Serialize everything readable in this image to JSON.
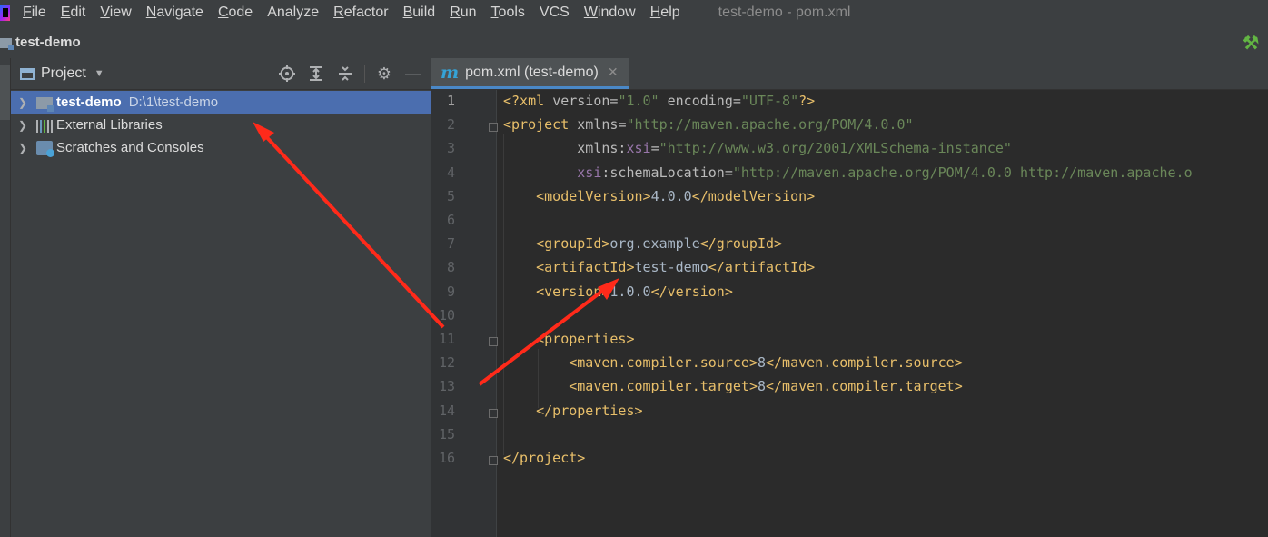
{
  "menu": {
    "items": [
      {
        "mn": "F",
        "rest": "ile"
      },
      {
        "mn": "E",
        "rest": "dit"
      },
      {
        "mn": "V",
        "rest": "iew"
      },
      {
        "mn": "N",
        "rest": "avigate"
      },
      {
        "mn": "C",
        "rest": "ode"
      },
      {
        "mn": "",
        "rest": "Analyze"
      },
      {
        "mn": "R",
        "rest": "efactor"
      },
      {
        "mn": "B",
        "rest": "uild"
      },
      {
        "mn": "R",
        "rest": "un"
      },
      {
        "mn": "T",
        "rest": "ools"
      },
      {
        "mn": "",
        "rest": "VCS"
      },
      {
        "mn": "W",
        "rest": "indow"
      },
      {
        "mn": "H",
        "rest": "elp"
      }
    ],
    "window_title": "test-demo - pom.xml"
  },
  "navbar": {
    "project_name": "test-demo"
  },
  "project_panel": {
    "title": "Project",
    "items": [
      {
        "name": "test-demo",
        "path": "D:\\1\\test-demo"
      },
      {
        "name": "External Libraries"
      },
      {
        "name": "Scratches and Consoles"
      }
    ]
  },
  "editor": {
    "tab_label": "pom.xml (test-demo)",
    "current_line": 1,
    "line_numbers": [
      "1",
      "2",
      "3",
      "4",
      "5",
      "6",
      "7",
      "8",
      "9",
      "10",
      "11",
      "12",
      "13",
      "14",
      "15",
      "16"
    ],
    "lines": [
      "<?xml version=\"1.0\" encoding=\"UTF-8\"?>",
      "<project xmlns=\"http://maven.apache.org/POM/4.0.0\"",
      "         xmlns:xsi=\"http://www.w3.org/2001/XMLSchema-instance\"",
      "         xsi:schemaLocation=\"http://maven.apache.org/POM/4.0.0 http://maven.apache.o",
      "    <modelVersion>4.0.0</modelVersion>",
      "",
      "    <groupId>org.example</groupId>",
      "    <artifactId>test-demo</artifactId>",
      "    <version>1.0.0</version>",
      "",
      "    <properties>",
      "        <maven.compiler.source>8</maven.compiler.source>",
      "        <maven.compiler.target>8</maven.compiler.target>",
      "    </properties>",
      "",
      "</project>"
    ]
  },
  "colors": {
    "tag": "#e8bf6a",
    "attribute": "#bababa",
    "value": "#6a8759",
    "namespace": "#9876aa",
    "text": "#a9b7c6",
    "selection": "#4b6eaf",
    "annotation_arrow": "#ff2a1a"
  },
  "icons": {
    "app": "intellij-logo-icon",
    "build": "hammer-icon",
    "file": "maven-icon"
  }
}
